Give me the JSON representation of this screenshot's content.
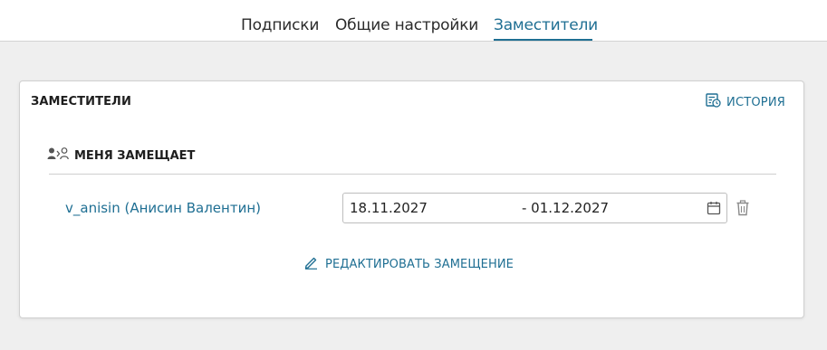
{
  "tabs": [
    {
      "label": "Подписки",
      "active": false
    },
    {
      "label": "Общие настройки",
      "active": false
    },
    {
      "label": "Заместители",
      "active": true
    }
  ],
  "card": {
    "title": "ЗАМЕСТИТЕЛИ",
    "history_label": "ИСТОРИЯ",
    "history_icon": "history-icon",
    "section": {
      "icon": "substitute-users-icon",
      "title": "МЕНЯ ЗАМЕЩАЕТ"
    },
    "deputy": {
      "name": "v_anisin (Анисин Валентин)",
      "date_start": "18.11.2027",
      "date_end": "- 01.12.2027",
      "calendar_icon": "calendar-icon",
      "delete_icon": "trash-icon"
    },
    "edit_label": "РЕДАКТИРОВАТЬ ЗАМЕЩЕНИЕ",
    "edit_icon": "pencil-icon"
  },
  "colors": {
    "accent": "#1f6f93",
    "background": "#efefef",
    "card": "#ffffff"
  }
}
